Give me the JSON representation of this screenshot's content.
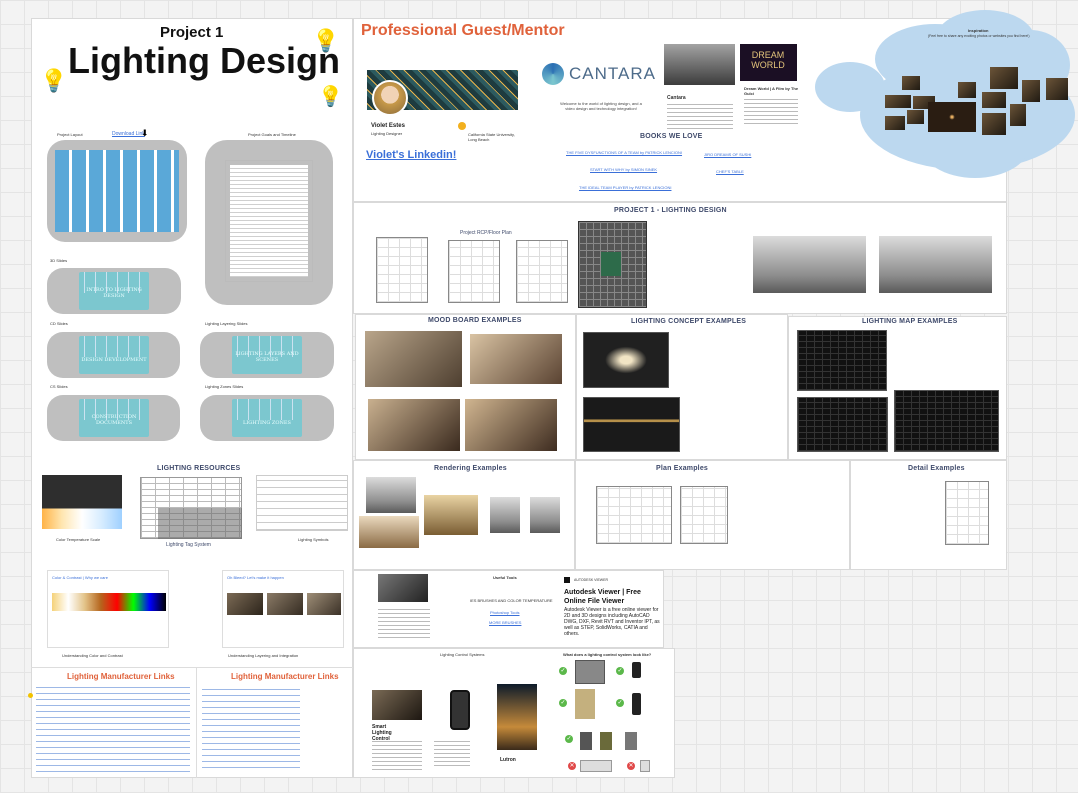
{
  "project": {
    "subtitle": "Project 1",
    "title": "Lighting Design"
  },
  "left_board": {
    "project_layout_label": "Project Layout",
    "download_link": "Download Link",
    "project_goals_label": "Project Goals and Timeline",
    "slides": [
      {
        "label": "3D Slides",
        "caption": "INTRO TO LIGHTING DESIGN"
      },
      {
        "label": "CD Slides",
        "caption": "DESIGN DEVELOPMENT"
      },
      {
        "label": "Lighting Layering Slides",
        "caption": "LIGHTING LAYERS AND SCENES"
      },
      {
        "label": "CS Slides",
        "caption": "CONSTRUCTION DOCUMENTS"
      },
      {
        "label": "Lighting Zones Slides",
        "caption": "LIGHTING ZONES"
      }
    ],
    "resources_title": "LIGHTING RESOURCES",
    "color_temp_caption": "Color Temperature Scale",
    "tag_system_caption": "Lighting Tag System",
    "symbols_caption": "Lighting Symbols",
    "color_contrast_title": "Color & Contrast | Why we care",
    "layering_title": "Oh Bleed? Let's make it happen",
    "understanding_color": "Understanding Color and Contrast",
    "understanding_layering": "Understanding Layering and Integration",
    "manufacturer_title_1": "Lighting Manufacturer Links",
    "manufacturer_title_2": "Lighting Manufacturer Links"
  },
  "mentor": {
    "heading": "Professional Guest/Mentor",
    "name": "Violet Estes",
    "role": "Lighting Designer",
    "school": "California State University, Long Beach",
    "linkedin": "Violet's Linkedin!",
    "cantara": "CANTARA",
    "cantara_desc": "Welcome to the world of lighting design, and a video design and technology integration!",
    "dream_title": "DREAM WORLD",
    "dream_caption": "Dream World | A Film by The Gulci",
    "cantara_caption": "Cantara",
    "books_title": "BOOKS WE LOVE",
    "books": [
      "THE FIVE DYSFUNCTIONS OF A TEAM by PATRICK LENCIONI",
      "JIRO DREAMS OF SUSHI",
      "START WITH WHY by SIMON SINEK",
      "CHEF'S TABLE",
      "THE IDEAL TEAM PLAYER by PATRICK LENCIONI"
    ]
  },
  "inspiration": {
    "title": "Inspiration",
    "subtitle": "(Feel free to share any exciting photos or websites you find here!)"
  },
  "project_section": {
    "title": "PROJECT 1 - LIGHTING DESIGN",
    "rcp_label": "Project RCP/Floor Plan",
    "mood_title": "MOOD BOARD EXAMPLES",
    "concept_title": "LIGHTING CONCEPT EXAMPLES",
    "map_title": "LIGHTING MAP EXAMPLES",
    "rendering_title": "Rendering Examples",
    "plan_title": "Plan Examples",
    "detail_title": "Detail Examples"
  },
  "useful_tools": {
    "title": "Useful Tools",
    "brushes": "IES BRUSHES AND COLOR TEMPERATURE",
    "photoshop": "Photoshop Tools",
    "more": "MORE BRUSHES",
    "autodesk_brand": "AUTODESK VIEWER",
    "autodesk_title": "Autodesk Viewer | Free Online File Viewer",
    "autodesk_desc": "Autodesk Viewer is a free online viewer for 2D and 3D designs including AutoCAD DWG, DXF, Revit RVT and Inventor IPT, as well as STEP, SolidWorks, CATIA and others."
  },
  "control_systems": {
    "title": "Lighting Control Systems",
    "question": "What does a lighting control system look like?",
    "caption_1": "Smart Lighting Control",
    "caption_2": "Lutron"
  },
  "colors": {
    "accent": "#e0623b",
    "title_blue": "#3f4a6b",
    "link": "#3a6fd8",
    "cloud": "#bcd8ef",
    "teal": "#7cc7cf"
  }
}
